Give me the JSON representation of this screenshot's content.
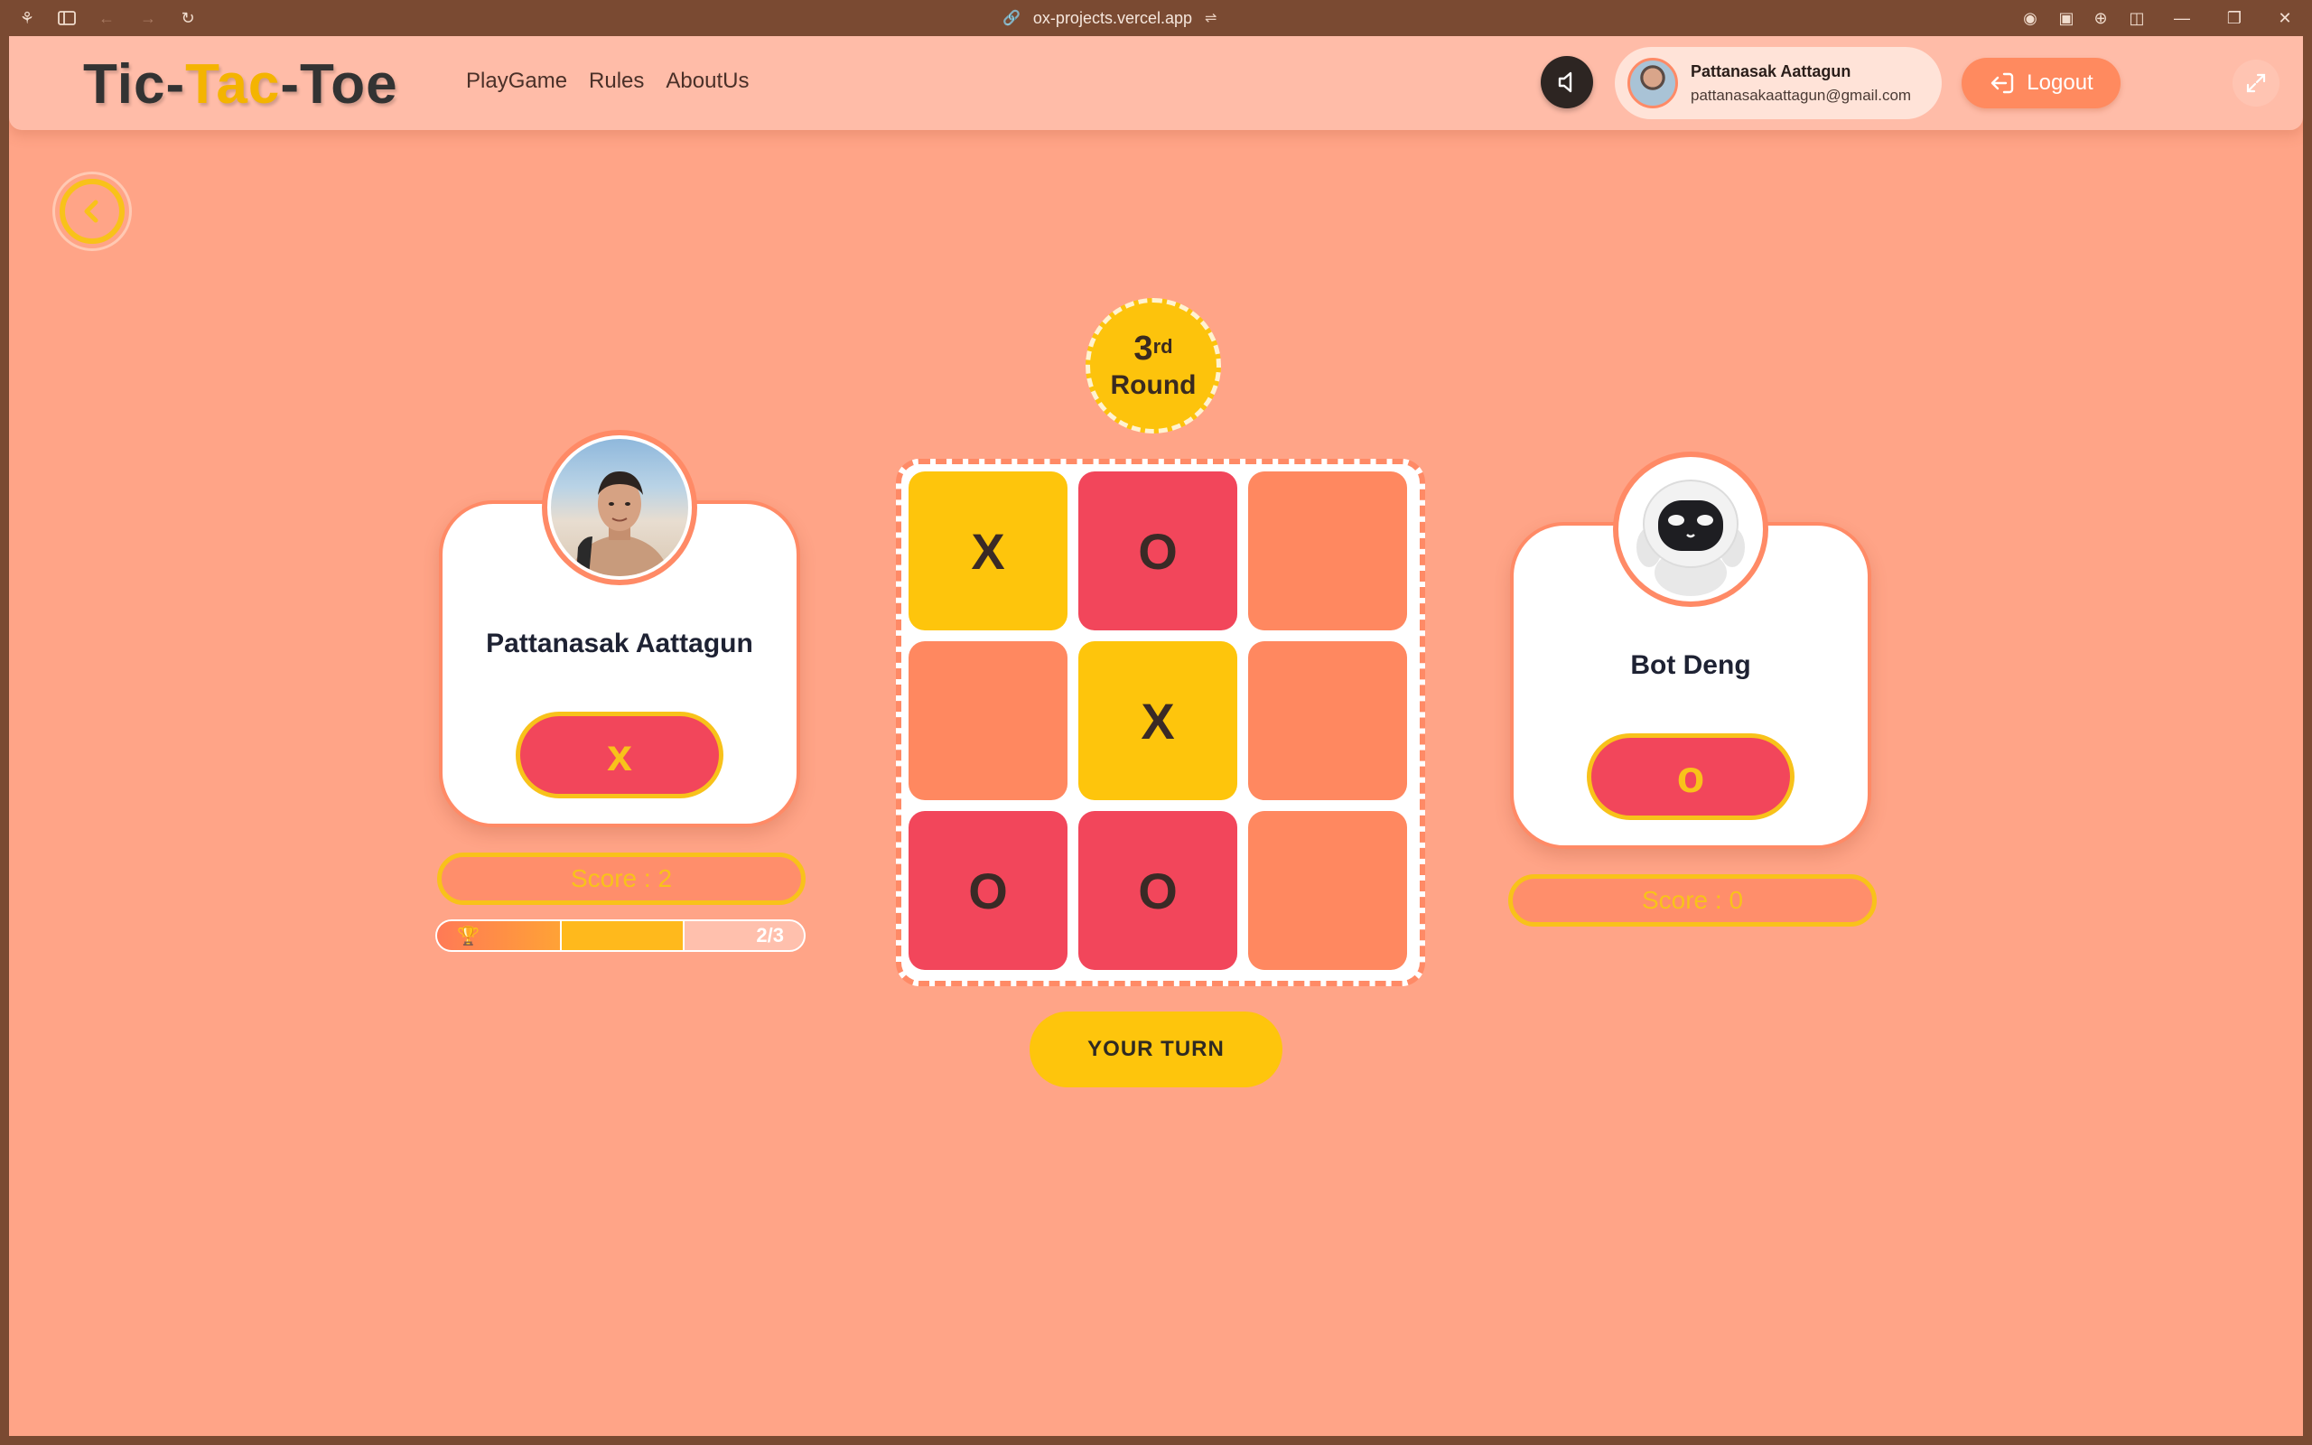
{
  "browser": {
    "url": "ox-projects.vercel.app"
  },
  "header": {
    "logo": {
      "part1": "Tic-",
      "part2": "Tac",
      "part3": "-Toe"
    },
    "nav": [
      {
        "label": "PlayGame"
      },
      {
        "label": "Rules"
      },
      {
        "label": "AboutUs"
      }
    ],
    "user": {
      "name": "Pattanasak Aattagun",
      "email": "pattanasakaattagun@gmail.com"
    },
    "logout_label": "Logout"
  },
  "round": {
    "number": "3",
    "suffix": "rd",
    "label": "Round"
  },
  "player": {
    "name": "Pattanasak Aattagun",
    "symbol": "x",
    "score_text": "Score : 2",
    "progress_text": "2/3",
    "progress_fraction": 0.667
  },
  "bot": {
    "name": "Bot Deng",
    "symbol": "o",
    "score_text": "Score : 0"
  },
  "board": {
    "cells": [
      "X",
      "O",
      "",
      "",
      "X",
      "",
      "O",
      "O",
      ""
    ]
  },
  "turn_label": "YOUR TURN",
  "colors": {
    "page_bg": "#ffa487",
    "header_bg": "#ffbca8",
    "accent_yellow": "#fec50c",
    "accent_red": "#f2465b",
    "empty_cell": "#ff8860",
    "logout_bg": "#ff8a5f"
  },
  "icons": {
    "sound": "speaker-icon",
    "back": "chevron-left-icon",
    "logout": "logout-icon",
    "expand": "expand-icon",
    "trophy": "trophy-icon"
  }
}
